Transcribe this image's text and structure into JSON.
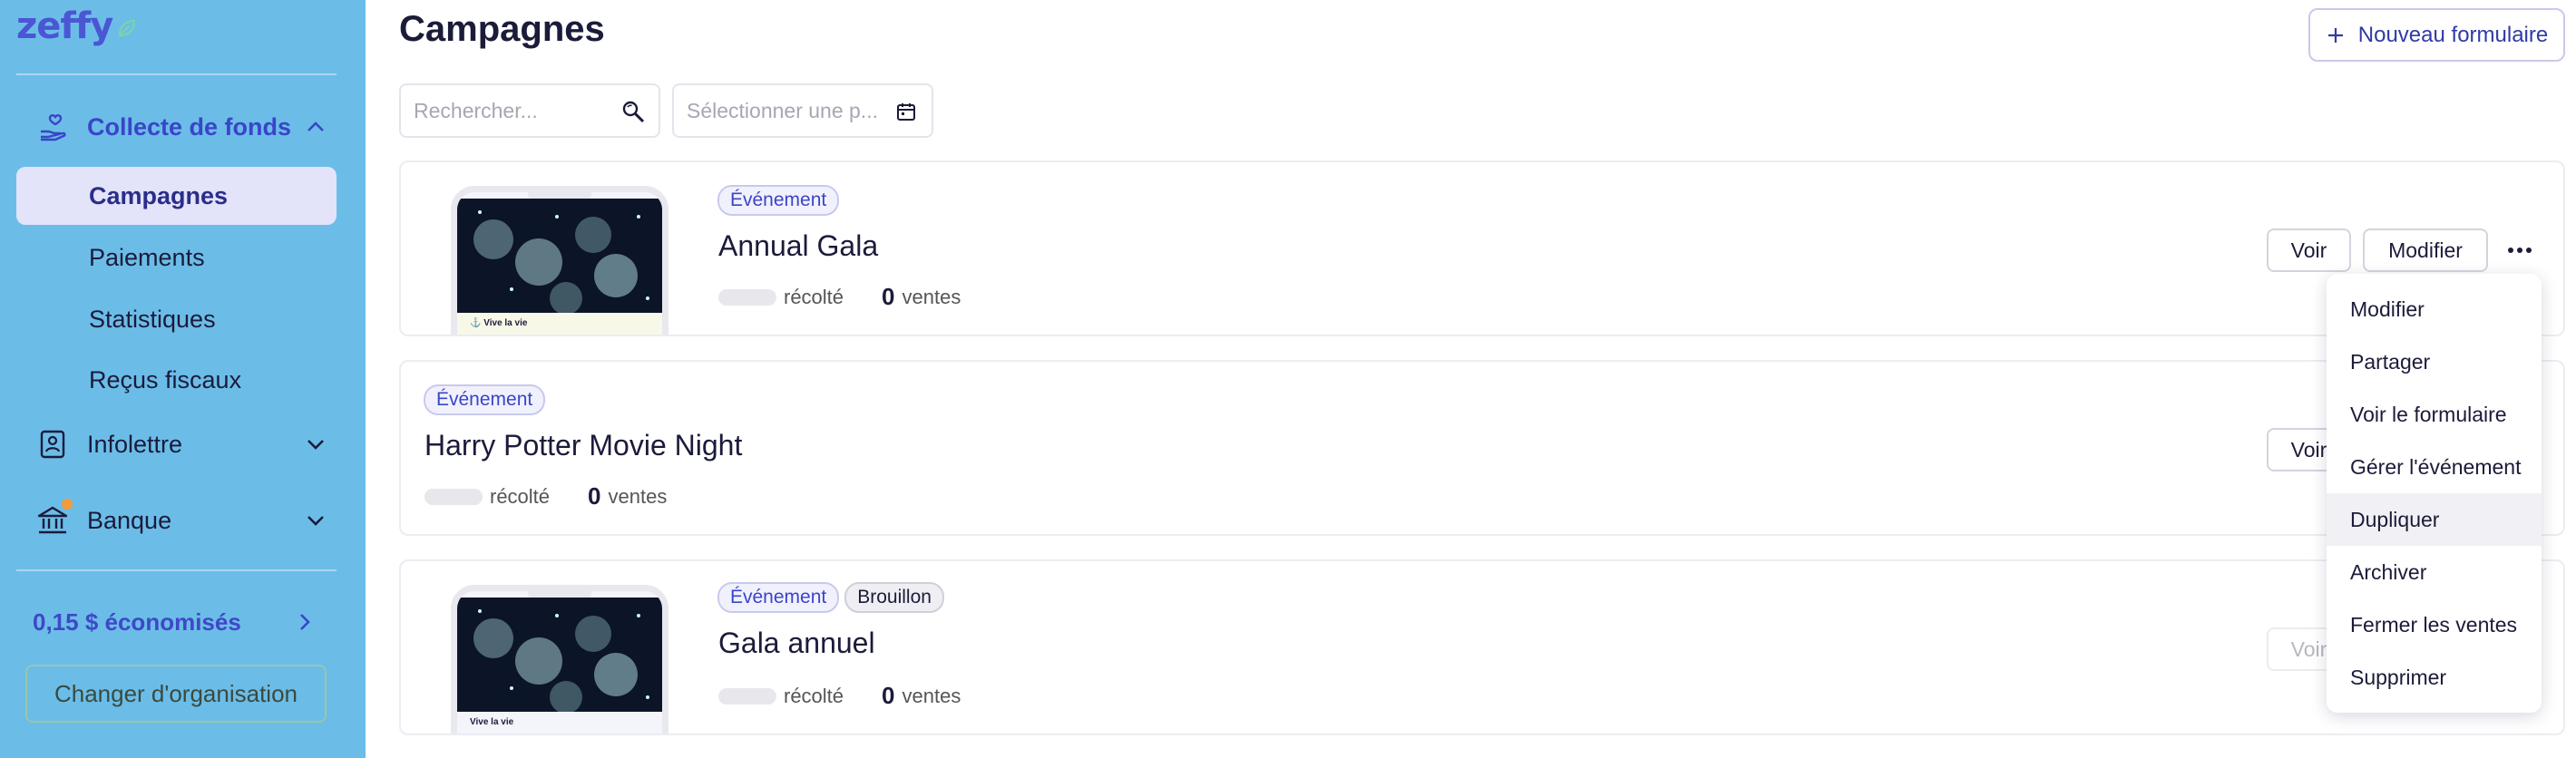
{
  "app": {
    "logo_text": "zeffy"
  },
  "sidebar": {
    "groups": [
      {
        "label": "Collecte de fonds",
        "icon": "hand-heart-icon",
        "expanded": true
      },
      {
        "label": "Infolettre",
        "icon": "newsletter-icon",
        "expanded": false
      },
      {
        "label": "Banque",
        "icon": "bank-icon",
        "expanded": false
      }
    ],
    "sub_items": [
      "Campagnes",
      "Paiements",
      "Statistiques",
      "Reçus fiscaux"
    ],
    "savings": "0,15 $ économisés",
    "change_org": "Changer d'organisation"
  },
  "main": {
    "title": "Campagnes",
    "new_form_button": "Nouveau formulaire",
    "search_placeholder": "Rechercher...",
    "date_placeholder": "Sélectionner une p..."
  },
  "campaigns": [
    {
      "badges": [
        "Événement"
      ],
      "title": "Annual Gala",
      "raised_label": "récolté",
      "sales_count": "0",
      "sales_label": "ventes",
      "thumb_caption": "Vive la vie",
      "buttons": [
        "Voir",
        "Modifier"
      ]
    },
    {
      "badges": [
        "Événement"
      ],
      "title": "Harry Potter Movie Night",
      "raised_label": "récolté",
      "sales_count": "0",
      "sales_label": "ventes",
      "buttons": [
        "Voir"
      ]
    },
    {
      "badges": [
        "Événement",
        "Brouillon"
      ],
      "title": "Gala annuel",
      "raised_label": "récolté",
      "sales_count": "0",
      "sales_label": "ventes",
      "thumb_caption": "Vive la vie",
      "buttons": [
        "Voir"
      ]
    }
  ],
  "dropdown_menu": {
    "items": [
      "Modifier",
      "Partager",
      "Voir le formulaire",
      "Gérer l'événement",
      "Dupliquer",
      "Archiver",
      "Fermer les ventes",
      "Supprimer"
    ],
    "hovered": "Dupliquer"
  },
  "colors": {
    "sidebar_bg": "#6bbde8",
    "accent": "#3a45c8",
    "selected_bg": "#e3e3fa",
    "notification_dot": "#f29a3c"
  }
}
